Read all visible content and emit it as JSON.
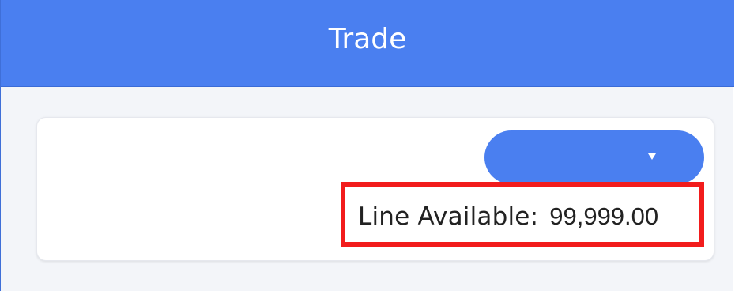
{
  "header": {
    "title": "Trade",
    "background": "#4a7ff0"
  },
  "card": {
    "dropdown": {
      "selected": "",
      "icon": "caret-down-icon"
    },
    "line_available": {
      "label": "Line  Available:",
      "value": "99,999.00"
    }
  },
  "annotation": {
    "highlight_color": "#f21c1c"
  }
}
